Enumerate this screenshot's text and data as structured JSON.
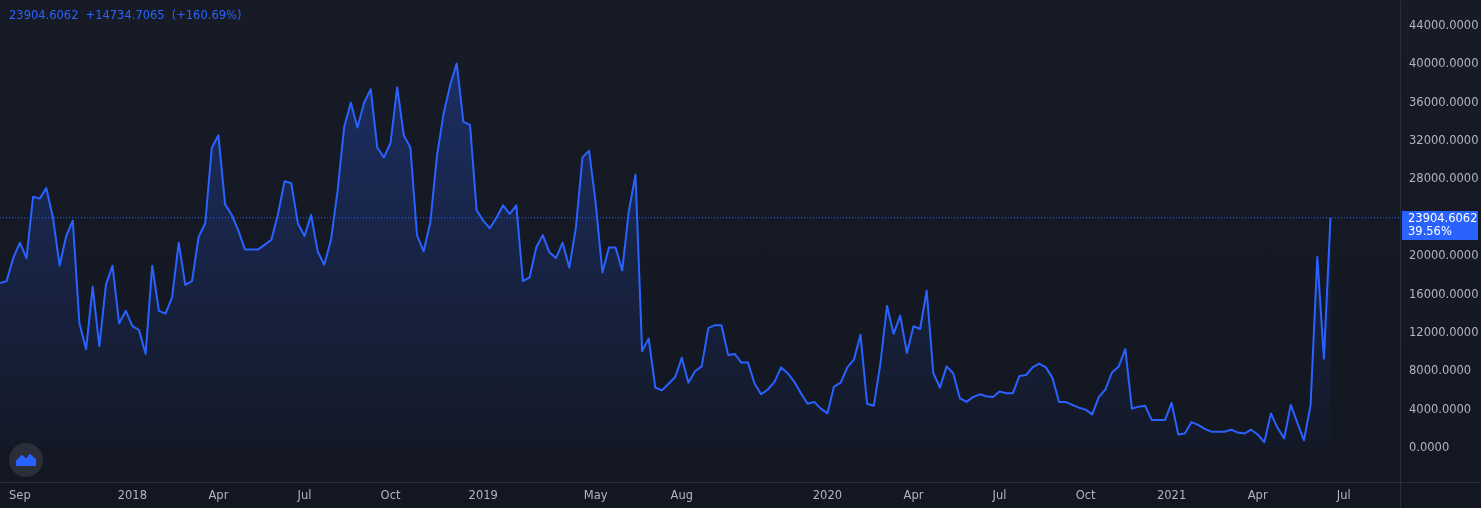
{
  "legend": {
    "price": "23904.6062",
    "change": "+14734.7065",
    "percent": "(+160.69%)"
  },
  "chart_data": {
    "type": "area",
    "ylim": [
      -3650,
      46610
    ],
    "categories": [
      null,
      null,
      null,
      "Sep",
      null,
      null,
      null,
      null,
      null,
      null,
      null,
      null,
      null,
      null,
      null,
      null,
      null,
      null,
      null,
      null,
      "2018",
      null,
      null,
      null,
      null,
      null,
      null,
      null,
      null,
      null,
      null,
      null,
      null,
      "Apr",
      null,
      null,
      null,
      null,
      null,
      null,
      null,
      null,
      null,
      null,
      null,
      null,
      "Jul",
      null,
      null,
      null,
      null,
      null,
      null,
      null,
      null,
      null,
      null,
      null,
      null,
      "Oct",
      null,
      null,
      null,
      null,
      null,
      null,
      null,
      null,
      null,
      null,
      null,
      null,
      null,
      "2019",
      null,
      null,
      null,
      null,
      null,
      null,
      null,
      null,
      null,
      null,
      null,
      null,
      null,
      null,
      null,
      null,
      "May",
      null,
      null,
      null,
      null,
      null,
      null,
      null,
      null,
      null,
      null,
      null,
      null,
      "Aug",
      null,
      null,
      null,
      null,
      null,
      null,
      null,
      null,
      null,
      null,
      null,
      null,
      null,
      null,
      null,
      null,
      null,
      null,
      null,
      null,
      null,
      "2020",
      null,
      null,
      null,
      null,
      null,
      null,
      null,
      null,
      null,
      null,
      null,
      null,
      "Apr",
      null,
      null,
      null,
      null,
      null,
      null,
      null,
      null,
      null,
      null,
      null,
      null,
      "Jul",
      null,
      null,
      null,
      null,
      null,
      null,
      null,
      null,
      null,
      null,
      null,
      null,
      "Oct",
      null,
      null,
      null,
      null,
      null,
      null,
      null,
      null,
      null,
      null,
      null,
      null,
      "2021",
      null,
      null,
      null,
      null,
      null,
      null,
      null,
      null,
      null,
      null,
      null,
      null,
      "Apr",
      null,
      null,
      null,
      null,
      null,
      null,
      null,
      null,
      null,
      null,
      null,
      null,
      "Jul"
    ],
    "ref_lines": [
      {
        "axis": "y",
        "value": 23904.6062,
        "label": "23904.6062",
        "color": "#2962ff"
      }
    ],
    "yticks": [
      {
        "value": 0,
        "label": "0.0000"
      },
      {
        "value": 4000,
        "label": "4000.0000"
      },
      {
        "value": 8000,
        "label": "8000.0000"
      },
      {
        "value": 12000,
        "label": "12000.0000"
      },
      {
        "value": 16000,
        "label": "16000.0000"
      },
      {
        "value": 20000,
        "label": "20000.0000"
      },
      {
        "value": 28000,
        "label": "28000.0000"
      },
      {
        "value": 32000,
        "label": "32000.0000"
      },
      {
        "value": 36000,
        "label": "36000.0000"
      },
      {
        "value": 40000,
        "label": "40000.0000"
      },
      {
        "value": 44000,
        "label": "44000.0000"
      }
    ],
    "series": [
      {
        "color": "#2962ff",
        "values": [
          17100,
          17300,
          19700,
          21300,
          19700,
          26100,
          25900,
          27000,
          23900,
          18900,
          22000,
          23600,
          12900,
          10200,
          16700,
          10500,
          16900,
          18900,
          12900,
          14200,
          12600,
          12200,
          9700,
          18900,
          14200,
          13900,
          15600,
          21300,
          16900,
          17300,
          21900,
          23300,
          31200,
          32500,
          25300,
          24200,
          22600,
          20600,
          20600,
          20600,
          21100,
          21600,
          24300,
          27700,
          27500,
          23300,
          22000,
          24200,
          20400,
          19000,
          21600,
          26700,
          33400,
          35900,
          33300,
          35900,
          37300,
          31200,
          30200,
          31700,
          37500,
          32500,
          31200,
          22100,
          20400,
          23400,
          30300,
          34700,
          37700,
          40000,
          33900,
          33600,
          24700,
          23600,
          22800,
          23900,
          25200,
          24300,
          25200,
          17300,
          17700,
          20800,
          22100,
          20300,
          19700,
          21300,
          18700,
          22900,
          30200,
          30900,
          25400,
          18200,
          20800,
          20800,
          18400,
          24600,
          28400,
          10000,
          11300,
          6200,
          5900,
          6600,
          7300,
          9300,
          6700,
          7900,
          8400,
          12400,
          12700,
          12700,
          9600,
          9700,
          8800,
          8800,
          6600,
          5500,
          6000,
          6800,
          8300,
          7700,
          6800,
          5600,
          4500,
          4700,
          4000,
          3500,
          6300,
          6700,
          8300,
          9100,
          11700,
          4500,
          4300,
          8700,
          14700,
          11800,
          13700,
          9800,
          12600,
          12300,
          16300,
          7700,
          6200,
          8400,
          7700,
          5100,
          4700,
          5200,
          5500,
          5300,
          5200,
          5800,
          5600,
          5600,
          7400,
          7500,
          8300,
          8700,
          8300,
          7200,
          4700,
          4700,
          4400,
          4100,
          3900,
          3400,
          5200,
          6000,
          7800,
          8400,
          10200,
          4000,
          4200,
          4300,
          2800,
          2800,
          2800,
          4600,
          1300,
          1400,
          2600,
          2300,
          1900,
          1600,
          1600,
          1600,
          1800,
          1500,
          1400,
          1800,
          1300,
          500,
          3500,
          2000,
          900,
          4400,
          2500,
          700,
          4400,
          19800,
          9200,
          23900,
          null,
          null
        ]
      }
    ]
  },
  "last_price": {
    "change": "39.56%"
  }
}
